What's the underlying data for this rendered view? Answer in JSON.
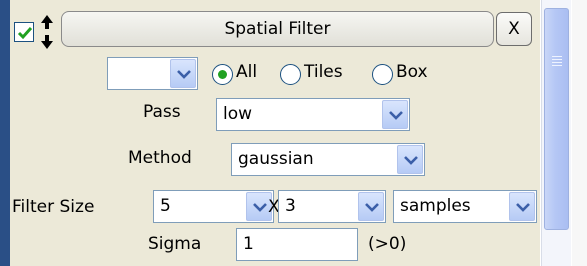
{
  "header": {
    "title": "Spatial Filter",
    "close_label": "X",
    "enabled": true
  },
  "region": {
    "selected": "",
    "options": [
      {
        "label": "All",
        "selected": true
      },
      {
        "label": "Tiles",
        "selected": false
      },
      {
        "label": "Box",
        "selected": false
      }
    ]
  },
  "pass": {
    "label": "Pass",
    "value": "low"
  },
  "method": {
    "label": "Method",
    "value": "gaussian"
  },
  "filter_size": {
    "label": "Filter Size",
    "x_value": "5",
    "separator": "X",
    "y_value": "3",
    "unit": "samples"
  },
  "sigma": {
    "label": "Sigma",
    "value": "1",
    "hint": "(>0)"
  }
}
